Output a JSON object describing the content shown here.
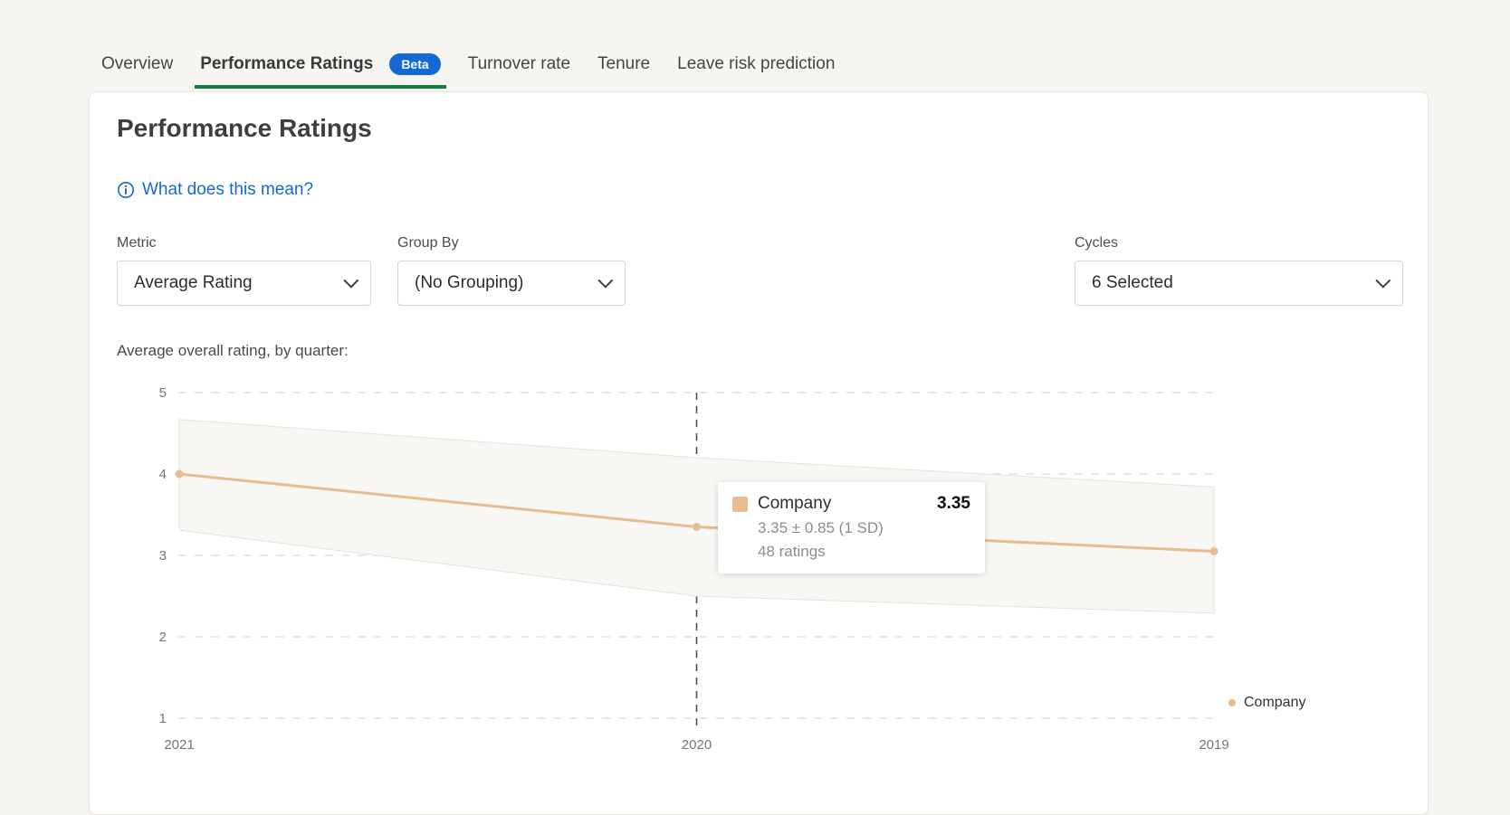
{
  "tabs": [
    {
      "label": "Overview",
      "active": false
    },
    {
      "label": "Performance Ratings",
      "active": true,
      "badge": "Beta"
    },
    {
      "label": "Turnover rate",
      "active": false
    },
    {
      "label": "Tenure",
      "active": false
    },
    {
      "label": "Leave risk prediction",
      "active": false
    }
  ],
  "header": {
    "title": "Performance Ratings",
    "help_link": "What does this mean?"
  },
  "filters": {
    "metric": {
      "label": "Metric",
      "value": "Average Rating"
    },
    "group_by": {
      "label": "Group By",
      "value": "(No Grouping)"
    },
    "cycles": {
      "label": "Cycles",
      "value": "6 Selected"
    }
  },
  "chart_caption": "Average overall rating, by quarter:",
  "tooltip": {
    "series": "Company",
    "value": "3.35",
    "detail": "3.35 ± 0.85 (1 SD)",
    "ratings": "48 ratings"
  },
  "legend": {
    "label": "Company"
  },
  "chart_data": {
    "type": "line",
    "title": "Average overall rating, by quarter",
    "x": [
      "2021",
      "2020",
      "2019"
    ],
    "x_order": "descending",
    "series": [
      {
        "name": "Company",
        "values": [
          4.0,
          3.35,
          3.05
        ],
        "band_upper": [
          4.67,
          4.2,
          3.84
        ],
        "band_lower": [
          3.31,
          2.5,
          2.29
        ]
      }
    ],
    "ylim": [
      1,
      5
    ],
    "yticks": [
      5,
      4,
      3,
      2,
      1
    ],
    "grid": "dashed-horizontal",
    "highlight_x": "2020",
    "legend_position": "bottom-right",
    "colors": {
      "line": "#e9bb90",
      "point": "#e9bb90",
      "band_fill": "#f9f7f4",
      "band_stroke": "#e8e1d9",
      "grid": "#d9d9d9",
      "highlight_line": "#4f4f4f",
      "tick_text": "#767676"
    }
  }
}
